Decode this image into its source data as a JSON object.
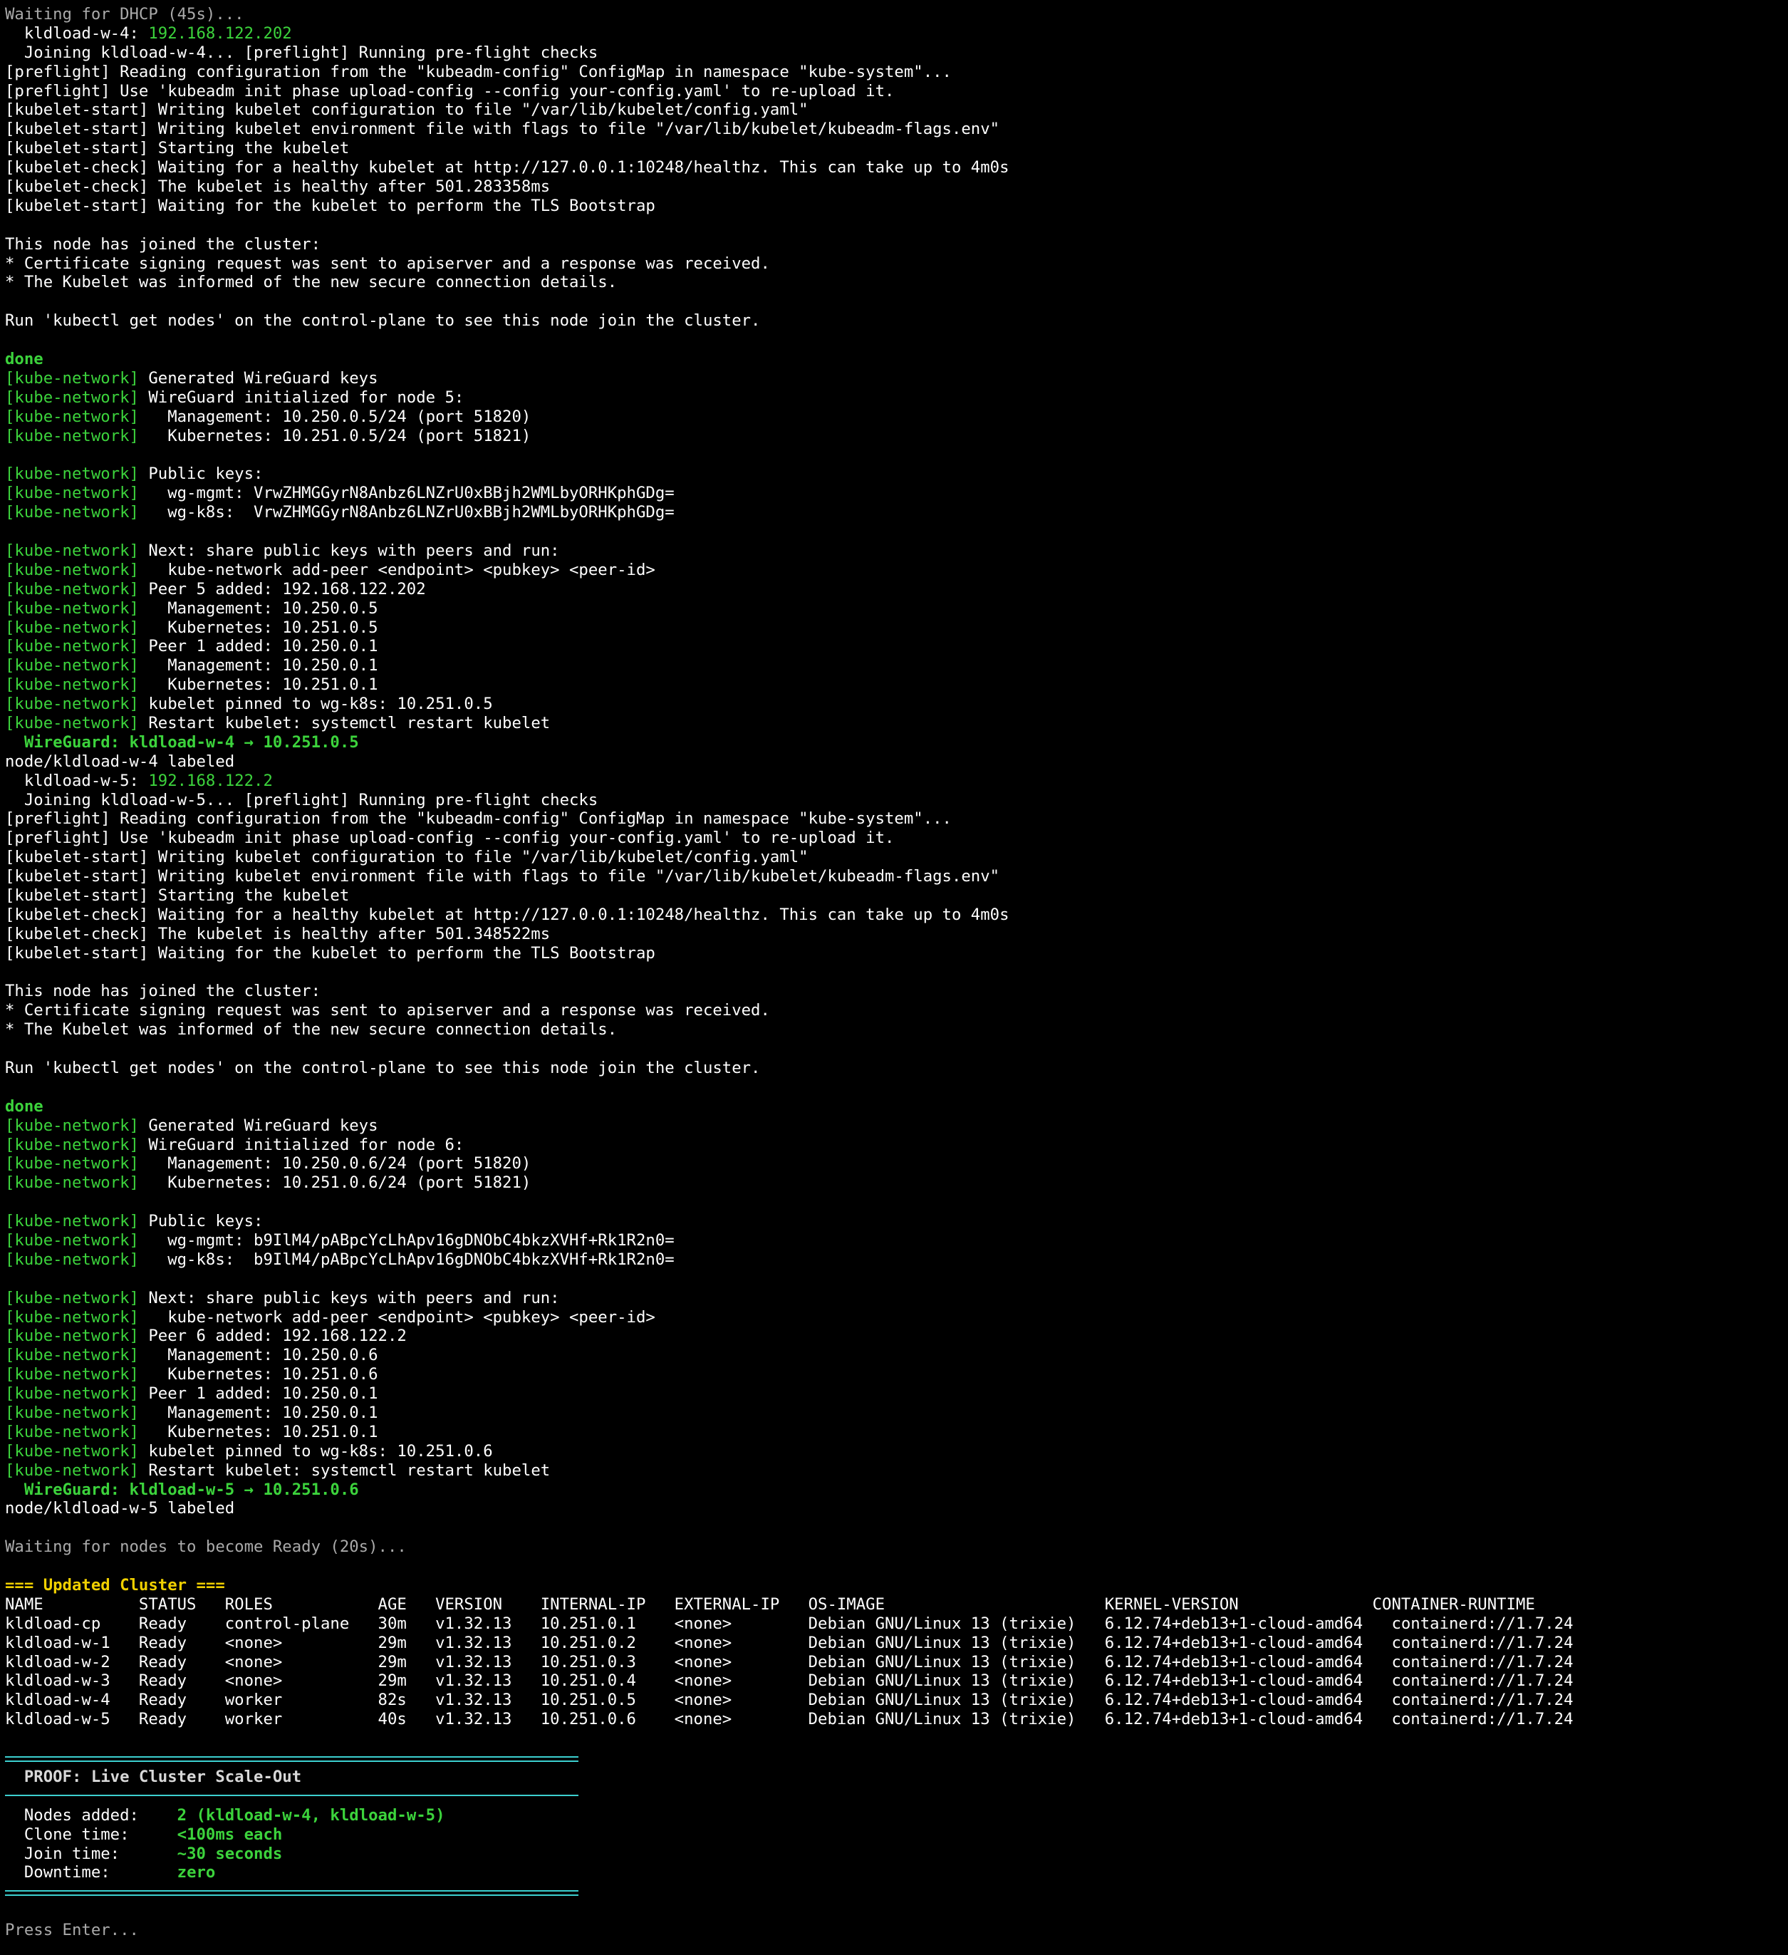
{
  "colors": {
    "background": "#000000",
    "text": "#ffffff",
    "dim": "#aaaaaa",
    "green": "#3cd33c",
    "yellow": "#f0d000",
    "cyan_rule": "#3cd0d0"
  },
  "terminal": {
    "lines": [
      {
        "kind": "gray",
        "text": "Waiting for DHCP (45s)..."
      },
      {
        "kind": "host",
        "pre": "  kldload-w-4: ",
        "ip": "192.168.122.202"
      },
      {
        "kind": "plain",
        "text": "  Joining kldload-w-4... [preflight] Running pre-flight checks"
      },
      {
        "kind": "plain",
        "text": "[preflight] Reading configuration from the \"kubeadm-config\" ConfigMap in namespace \"kube-system\"..."
      },
      {
        "kind": "plain",
        "text": "[preflight] Use 'kubeadm init phase upload-config --config your-config.yaml' to re-upload it."
      },
      {
        "kind": "plain",
        "text": "[kubelet-start] Writing kubelet configuration to file \"/var/lib/kubelet/config.yaml\""
      },
      {
        "kind": "plain",
        "text": "[kubelet-start] Writing kubelet environment file with flags to file \"/var/lib/kubelet/kubeadm-flags.env\""
      },
      {
        "kind": "plain",
        "text": "[kubelet-start] Starting the kubelet"
      },
      {
        "kind": "plain",
        "text": "[kubelet-check] Waiting for a healthy kubelet at http://127.0.0.1:10248/healthz. This can take up to 4m0s"
      },
      {
        "kind": "plain",
        "text": "[kubelet-check] The kubelet is healthy after 501.283358ms"
      },
      {
        "kind": "plain",
        "text": "[kubelet-start] Waiting for the kubelet to perform the TLS Bootstrap"
      },
      {
        "kind": "blank"
      },
      {
        "kind": "plain",
        "text": "This node has joined the cluster:"
      },
      {
        "kind": "plain",
        "text": "* Certificate signing request was sent to apiserver and a response was received."
      },
      {
        "kind": "plain",
        "text": "* The Kubelet was informed of the new secure connection details."
      },
      {
        "kind": "blank"
      },
      {
        "kind": "plain",
        "text": "Run 'kubectl get nodes' on the control-plane to see this node join the cluster."
      },
      {
        "kind": "blank"
      },
      {
        "kind": "greenbold",
        "text": "done"
      },
      {
        "kind": "net",
        "text": " Generated WireGuard keys"
      },
      {
        "kind": "net",
        "text": " WireGuard initialized for node 5:"
      },
      {
        "kind": "net",
        "text": "   Management: 10.250.0.5/24 (port 51820)"
      },
      {
        "kind": "net",
        "text": "   Kubernetes: 10.251.0.5/24 (port 51821)"
      },
      {
        "kind": "blank"
      },
      {
        "kind": "net",
        "text": " Public keys:"
      },
      {
        "kind": "net",
        "text": "   wg-mgmt: VrwZHMGGyrN8Anbz6LNZrU0xBBjh2WMLbyORHKphGDg="
      },
      {
        "kind": "net",
        "text": "   wg-k8s:  VrwZHMGGyrN8Anbz6LNZrU0xBBjh2WMLbyORHKphGDg="
      },
      {
        "kind": "blank"
      },
      {
        "kind": "net",
        "text": " Next: share public keys with peers and run:"
      },
      {
        "kind": "net",
        "text": "   kube-network add-peer <endpoint> <pubkey> <peer-id>"
      },
      {
        "kind": "net",
        "text": " Peer 5 added: 192.168.122.202"
      },
      {
        "kind": "net",
        "text": "   Management: 10.250.0.5"
      },
      {
        "kind": "net",
        "text": "   Kubernetes: 10.251.0.5"
      },
      {
        "kind": "net",
        "text": " Peer 1 added: 10.250.0.1"
      },
      {
        "kind": "net",
        "text": "   Management: 10.250.0.1"
      },
      {
        "kind": "net",
        "text": "   Kubernetes: 10.251.0.1"
      },
      {
        "kind": "net",
        "text": " kubelet pinned to wg-k8s: 10.251.0.5"
      },
      {
        "kind": "net",
        "text": " Restart kubelet: systemctl restart kubelet"
      },
      {
        "kind": "greenbold",
        "text": "  WireGuard: kldload-w-4 → 10.251.0.5"
      },
      {
        "kind": "plain",
        "text": "node/kldload-w-4 labeled"
      },
      {
        "kind": "host",
        "pre": "  kldload-w-5: ",
        "ip": "192.168.122.2"
      },
      {
        "kind": "plain",
        "text": "  Joining kldload-w-5... [preflight] Running pre-flight checks"
      },
      {
        "kind": "plain",
        "text": "[preflight] Reading configuration from the \"kubeadm-config\" ConfigMap in namespace \"kube-system\"..."
      },
      {
        "kind": "plain",
        "text": "[preflight] Use 'kubeadm init phase upload-config --config your-config.yaml' to re-upload it."
      },
      {
        "kind": "plain",
        "text": "[kubelet-start] Writing kubelet configuration to file \"/var/lib/kubelet/config.yaml\""
      },
      {
        "kind": "plain",
        "text": "[kubelet-start] Writing kubelet environment file with flags to file \"/var/lib/kubelet/kubeadm-flags.env\""
      },
      {
        "kind": "plain",
        "text": "[kubelet-start] Starting the kubelet"
      },
      {
        "kind": "plain",
        "text": "[kubelet-check] Waiting for a healthy kubelet at http://127.0.0.1:10248/healthz. This can take up to 4m0s"
      },
      {
        "kind": "plain",
        "text": "[kubelet-check] The kubelet is healthy after 501.348522ms"
      },
      {
        "kind": "plain",
        "text": "[kubelet-start] Waiting for the kubelet to perform the TLS Bootstrap"
      },
      {
        "kind": "blank"
      },
      {
        "kind": "plain",
        "text": "This node has joined the cluster:"
      },
      {
        "kind": "plain",
        "text": "* Certificate signing request was sent to apiserver and a response was received."
      },
      {
        "kind": "plain",
        "text": "* The Kubelet was informed of the new secure connection details."
      },
      {
        "kind": "blank"
      },
      {
        "kind": "plain",
        "text": "Run 'kubectl get nodes' on the control-plane to see this node join the cluster."
      },
      {
        "kind": "blank"
      },
      {
        "kind": "greenbold",
        "text": "done"
      },
      {
        "kind": "net",
        "text": " Generated WireGuard keys"
      },
      {
        "kind": "net",
        "text": " WireGuard initialized for node 6:"
      },
      {
        "kind": "net",
        "text": "   Management: 10.250.0.6/24 (port 51820)"
      },
      {
        "kind": "net",
        "text": "   Kubernetes: 10.251.0.6/24 (port 51821)"
      },
      {
        "kind": "blank"
      },
      {
        "kind": "net",
        "text": " Public keys:"
      },
      {
        "kind": "net",
        "text": "   wg-mgmt: b9IlM4/pABpcYcLhApv16gDNObC4bkzXVHf+Rk1R2n0="
      },
      {
        "kind": "net",
        "text": "   wg-k8s:  b9IlM4/pABpcYcLhApv16gDNObC4bkzXVHf+Rk1R2n0="
      },
      {
        "kind": "blank"
      },
      {
        "kind": "net",
        "text": " Next: share public keys with peers and run:"
      },
      {
        "kind": "net",
        "text": "   kube-network add-peer <endpoint> <pubkey> <peer-id>"
      },
      {
        "kind": "net",
        "text": " Peer 6 added: 192.168.122.2"
      },
      {
        "kind": "net",
        "text": "   Management: 10.250.0.6"
      },
      {
        "kind": "net",
        "text": "   Kubernetes: 10.251.0.6"
      },
      {
        "kind": "net",
        "text": " Peer 1 added: 10.250.0.1"
      },
      {
        "kind": "net",
        "text": "   Management: 10.250.0.1"
      },
      {
        "kind": "net",
        "text": "   Kubernetes: 10.251.0.1"
      },
      {
        "kind": "net",
        "text": " kubelet pinned to wg-k8s: 10.251.0.6"
      },
      {
        "kind": "net",
        "text": " Restart kubelet: systemctl restart kubelet"
      },
      {
        "kind": "greenbold",
        "text": "  WireGuard: kldload-w-5 → 10.251.0.6"
      },
      {
        "kind": "plain",
        "text": "node/kldload-w-5 labeled"
      },
      {
        "kind": "blank"
      },
      {
        "kind": "gray",
        "text": "Waiting for nodes to become Ready (20s)..."
      },
      {
        "kind": "blank"
      },
      {
        "kind": "yellowbold",
        "text": "=== Updated Cluster ==="
      },
      {
        "kind": "plain",
        "text": "NAME          STATUS   ROLES           AGE   VERSION    INTERNAL-IP   EXTERNAL-IP   OS-IMAGE                       KERNEL-VERSION              CONTAINER-RUNTIME"
      },
      {
        "kind": "plain",
        "text": "kldload-cp    Ready    control-plane   30m   v1.32.13   10.251.0.1    <none>        Debian GNU/Linux 13 (trixie)   6.12.74+deb13+1-cloud-amd64   containerd://1.7.24"
      },
      {
        "kind": "plain",
        "text": "kldload-w-1   Ready    <none>          29m   v1.32.13   10.251.0.2    <none>        Debian GNU/Linux 13 (trixie)   6.12.74+deb13+1-cloud-amd64   containerd://1.7.24"
      },
      {
        "kind": "plain",
        "text": "kldload-w-2   Ready    <none>          29m   v1.32.13   10.251.0.3    <none>        Debian GNU/Linux 13 (trixie)   6.12.74+deb13+1-cloud-amd64   containerd://1.7.24"
      },
      {
        "kind": "plain",
        "text": "kldload-w-3   Ready    <none>          29m   v1.32.13   10.251.0.4    <none>        Debian GNU/Linux 13 (trixie)   6.12.74+deb13+1-cloud-amd64   containerd://1.7.24"
      },
      {
        "kind": "plain",
        "text": "kldload-w-4   Ready    worker          82s   v1.32.13   10.251.0.5    <none>        Debian GNU/Linux 13 (trixie)   6.12.74+deb13+1-cloud-amd64   containerd://1.7.24"
      },
      {
        "kind": "plain",
        "text": "kldload-w-5   Ready    worker          40s   v1.32.13   10.251.0.6    <none>        Debian GNU/Linux 13 (trixie)   6.12.74+deb13+1-cloud-amd64   containerd://1.7.24"
      },
      {
        "kind": "blank"
      },
      {
        "kind": "rule-double"
      },
      {
        "kind": "title",
        "text": "  PROOF: Live Cluster Scale-Out"
      },
      {
        "kind": "rule"
      },
      {
        "kind": "kv",
        "key": "  Nodes added:    ",
        "val": "2 (kldload-w-4, kldload-w-5)"
      },
      {
        "kind": "kv",
        "key": "  Clone time:     ",
        "val": "<100ms each"
      },
      {
        "kind": "kv",
        "key": "  Join time:      ",
        "val": "~30 seconds"
      },
      {
        "kind": "kv",
        "key": "  Downtime:       ",
        "val": "zero"
      },
      {
        "kind": "rule-double"
      },
      {
        "kind": "blank"
      },
      {
        "kind": "prompt",
        "text": "Press Enter..."
      }
    ],
    "net_tag": "[kube-network]"
  }
}
